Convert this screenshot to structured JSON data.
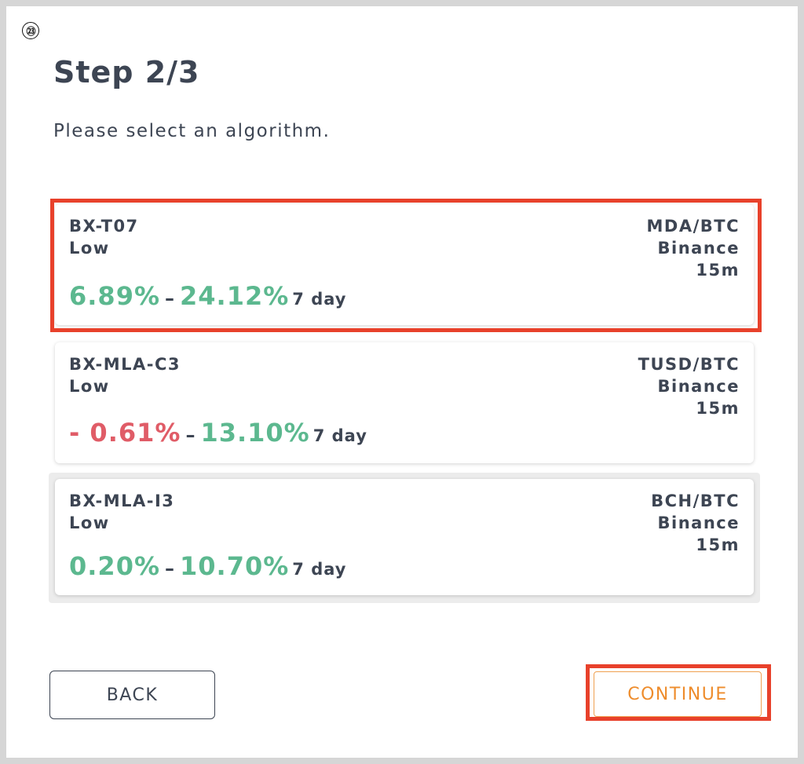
{
  "badge": "㉓",
  "title": "Step 2/3",
  "subtitle": "Please select an algorithm.",
  "algorithms": [
    {
      "name": "BX-T07",
      "risk": "Low",
      "pair": "MDA/BTC",
      "exchange": "Binance",
      "interval": "15m",
      "range_low": "6.89%",
      "range_high": "24.12%",
      "separator": "–",
      "period": "7 day",
      "range_low_color": "#5cb88f",
      "selected": true
    },
    {
      "name": "BX-MLA-C3",
      "risk": "Low",
      "pair": "TUSD/BTC",
      "exchange": "Binance",
      "interval": "15m",
      "range_low": "- 0.61%",
      "range_high": "13.10%",
      "separator": "–",
      "period": "7 day",
      "range_low_color": "#e05c67",
      "selected": false
    },
    {
      "name": "BX-MLA-I3",
      "risk": "Low",
      "pair": "BCH/BTC",
      "exchange": "Binance",
      "interval": "15m",
      "range_low": "0.20%",
      "range_high": "10.70%",
      "separator": "–",
      "period": "7 day",
      "range_low_color": "#5cb88f",
      "selected": false
    }
  ],
  "buttons": {
    "back": "BACK",
    "continue": "CONTINUE"
  },
  "colors": {
    "positive": "#5cb88f",
    "negative": "#e05c67",
    "highlight": "#e8412b",
    "accent": "#ee8c2c"
  }
}
